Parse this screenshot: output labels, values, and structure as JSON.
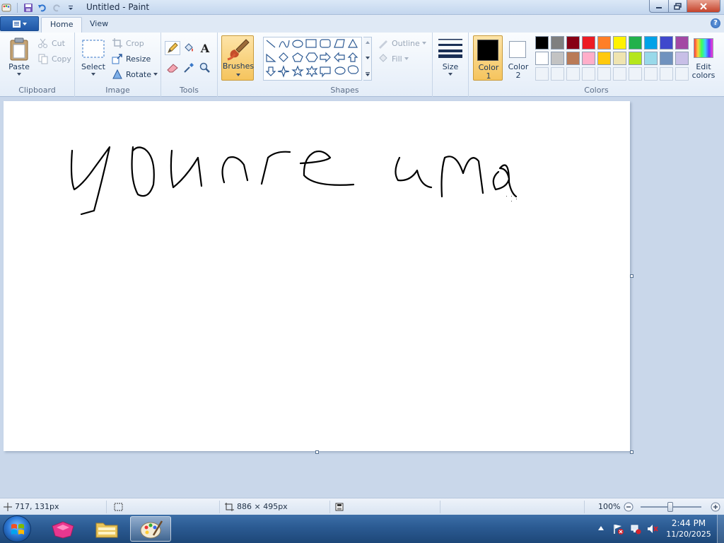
{
  "window": {
    "title": "Untitled - Paint"
  },
  "tabs": {
    "home": "Home",
    "view": "View"
  },
  "clipboard": {
    "paste": "Paste",
    "cut": "Cut",
    "copy": "Copy",
    "label": "Clipboard"
  },
  "image": {
    "select": "Select",
    "crop": "Crop",
    "resize": "Resize",
    "rotate": "Rotate",
    "label": "Image"
  },
  "tools": {
    "label": "Tools",
    "text_glyph": "A"
  },
  "brushes": {
    "label": "Brushes"
  },
  "shapes": {
    "outline": "Outline",
    "fill": "Fill",
    "label": "Shapes"
  },
  "size": {
    "label": "Size"
  },
  "colors": {
    "color1_line1": "Color",
    "color1_line2": "1",
    "color2_line1": "Color",
    "color2_line2": "2",
    "edit_line1": "Edit",
    "edit_line2": "colors",
    "label": "Colors",
    "color1_value": "#000000",
    "color2_value": "#ffffff",
    "palette_row1": [
      "#000000",
      "#7f7f7f",
      "#880015",
      "#ed1c24",
      "#ff7f27",
      "#fff200",
      "#22b14c",
      "#00a2e8",
      "#3f48cc",
      "#a349a4"
    ],
    "palette_row2": [
      "#ffffff",
      "#c3c3c3",
      "#b97a57",
      "#ffaec9",
      "#ffc90e",
      "#efe4b0",
      "#b5e61d",
      "#99d9ea",
      "#7092be",
      "#c8bfe7"
    ]
  },
  "status": {
    "cursor_pos": "717, 131px",
    "canvas_size": "886 × 495px",
    "zoom": "100%"
  },
  "taskbar": {
    "time": "2:44 PM",
    "date": "11/20/2025"
  }
}
